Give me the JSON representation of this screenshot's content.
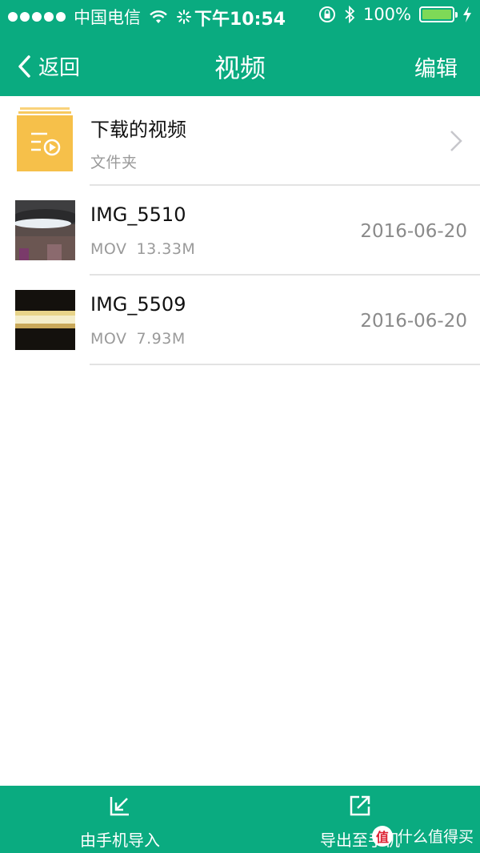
{
  "status_bar": {
    "carrier": "中国电信",
    "time": "下午10:54",
    "battery": "100%",
    "battery_level": 1.0
  },
  "nav": {
    "back_label": "返回",
    "title": "视频",
    "edit_label": "编辑"
  },
  "folder": {
    "name": "下载的视频",
    "subtitle": "文件夹"
  },
  "videos": [
    {
      "name": "IMG_5510",
      "type": "MOV",
      "size": "13.33M",
      "date": "2016-06-20"
    },
    {
      "name": "IMG_5509",
      "type": "MOV",
      "size": "7.93M",
      "date": "2016-06-20"
    }
  ],
  "bottom_bar": {
    "import_label": "由手机导入",
    "export_label": "导出至手机"
  },
  "watermark": {
    "badge": "值",
    "text": "什么值得买"
  },
  "colors": {
    "brand_green": "#0aab80",
    "folder_yellow": "#f6c04a"
  },
  "icons": [
    "back-chevron-icon",
    "wifi-icon",
    "loading-icon",
    "lock-rotation-icon",
    "bluetooth-icon",
    "battery-icon",
    "charging-icon",
    "chevron-right-icon",
    "import-icon",
    "export-icon"
  ]
}
